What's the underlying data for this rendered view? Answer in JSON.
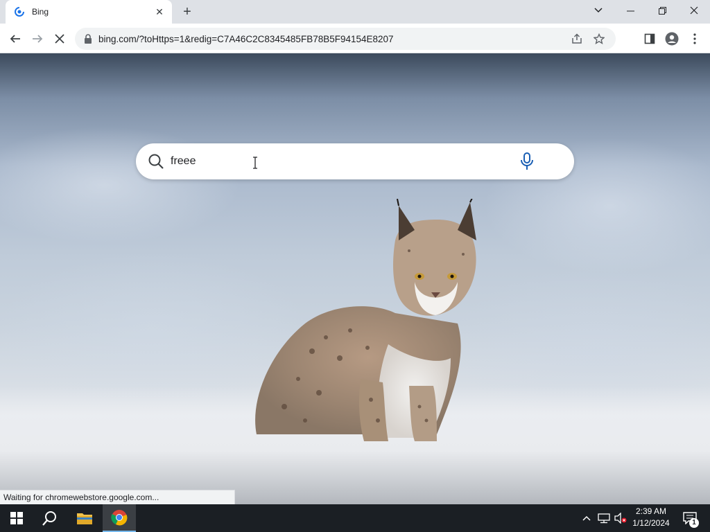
{
  "browser": {
    "tab": {
      "title": "Bing",
      "favicon": "bing-loading-icon"
    },
    "new_tab_icon": "plus-icon",
    "window_controls": [
      "chevron-down-icon",
      "minimize-icon",
      "restore-icon",
      "close-icon"
    ],
    "url": "bing.com/?toHttps=1&redig=C7A46C2C8345485FB78B5F94154E8207",
    "status": "Waiting for chromewebstore.google.com..."
  },
  "search": {
    "value": "freee",
    "icon": "search-icon",
    "voice_icon": "microphone-icon"
  },
  "taskbar": {
    "time": "2:39 AM",
    "date": "1/12/2024",
    "notification_count": "1"
  },
  "colors": {
    "accent": "#1a73e8",
    "taskbar": "#1b1f24",
    "chrome_frame": "#dee1e6"
  }
}
